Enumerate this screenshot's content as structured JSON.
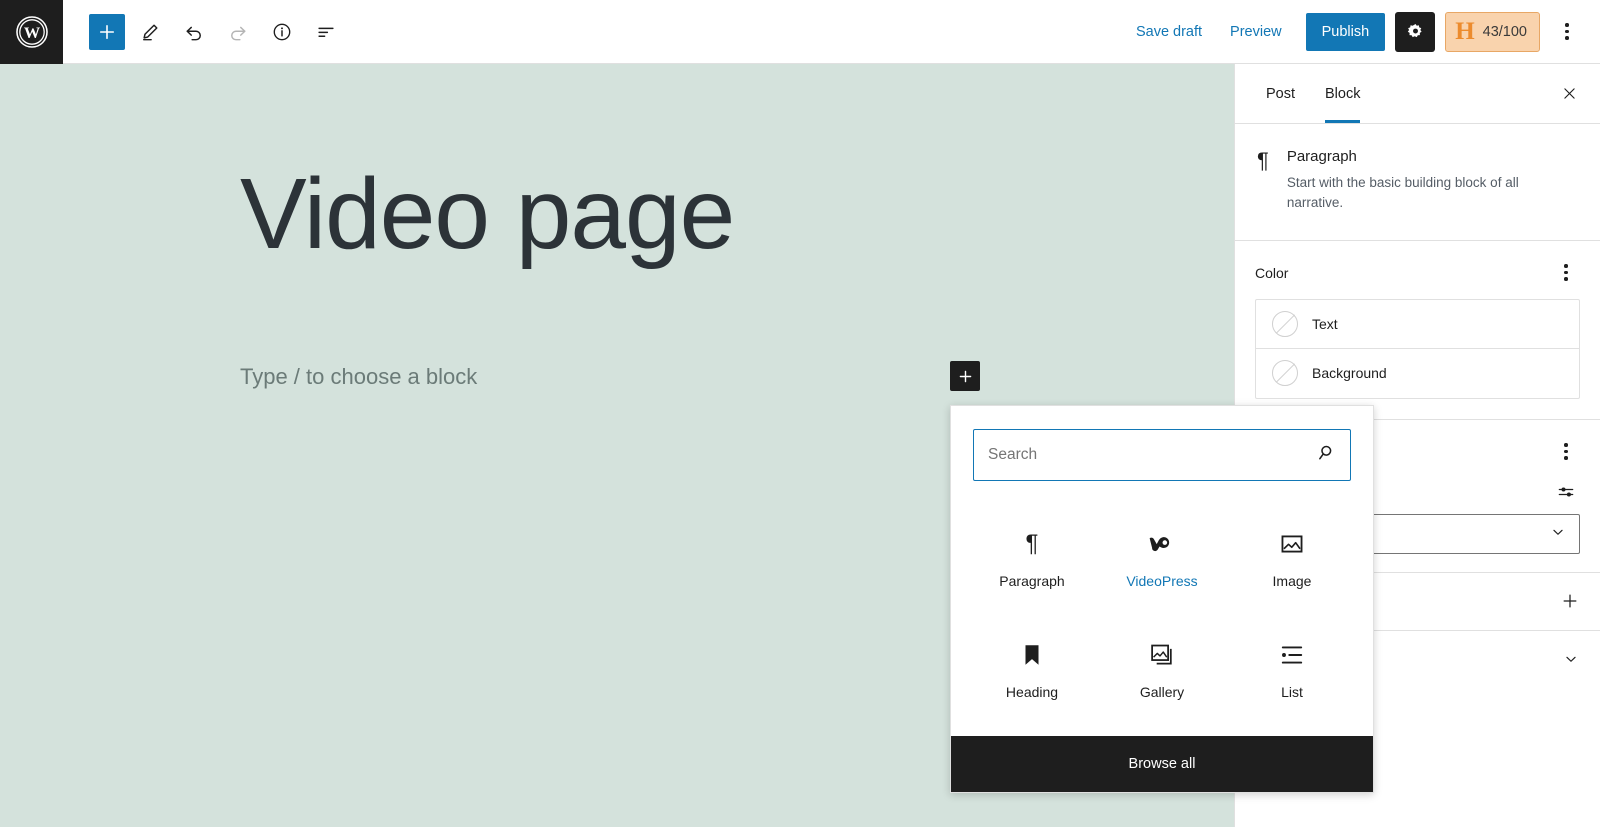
{
  "topbar": {
    "logo_icon": "wordpress-logo-icon",
    "left_tools": [
      {
        "name": "add-block-button",
        "icon": "plus-icon",
        "label": "Toggle block inserter",
        "variant": "primary"
      },
      {
        "name": "tools-button",
        "icon": "pencil-icon",
        "label": "Tools",
        "variant": "plain"
      },
      {
        "name": "undo-button",
        "icon": "undo-arrow-icon",
        "label": "Undo",
        "variant": "plain"
      },
      {
        "name": "redo-button",
        "icon": "redo-arrow-icon",
        "label": "Redo",
        "variant": "disabled"
      },
      {
        "name": "details-button",
        "icon": "info-circle-icon",
        "label": "Details",
        "variant": "plain"
      },
      {
        "name": "list-view-button",
        "icon": "list-view-icon",
        "label": "List view",
        "variant": "plain"
      }
    ],
    "save_draft_label": "Save draft",
    "preview_label": "Preview",
    "publish_label": "Publish",
    "settings_icon": "gear-icon",
    "seo_badge": {
      "mark": "H",
      "score": "43/100"
    },
    "more_menu_icon": "kebab-menu-icon"
  },
  "canvas": {
    "background_color": "#d4e2dc",
    "post_title": "Video page",
    "paragraph_placeholder": "Type / to choose a block",
    "inline_inserter_icon": "plus-icon"
  },
  "sidebar": {
    "tabs": [
      {
        "label": "Post",
        "active": false
      },
      {
        "label": "Block",
        "active": true
      }
    ],
    "close_icon": "close-x-icon",
    "block_info": {
      "icon": "paragraph-pilcrow-icon",
      "title": "Paragraph",
      "description": "Start with the basic building block of all narrative."
    },
    "color_panel": {
      "title": "Color",
      "menu_icon": "kebab-menu-icon",
      "rows": [
        {
          "label": "Text",
          "swatch": "none"
        },
        {
          "label": "Background",
          "swatch": "none"
        }
      ]
    },
    "typography_panel": {
      "menu_icon": "kebab-menu-icon",
      "options_icon": "sliders-icon",
      "select_value": "",
      "select_chevron_icon": "chevron-down-icon"
    },
    "dimensions_panel": {
      "title": "",
      "action_icon": "plus-icon"
    },
    "advanced_panel": {
      "title": "",
      "action_icon": "chevron-down-icon"
    }
  },
  "inserter": {
    "search": {
      "placeholder": "Search",
      "value": "",
      "icon": "search-magnifier-icon"
    },
    "blocks": [
      {
        "label": "Paragraph",
        "icon": "paragraph-pilcrow-icon",
        "accent": false
      },
      {
        "label": "VideoPress",
        "icon": "videopress-logo-icon",
        "accent": true
      },
      {
        "label": "Image",
        "icon": "image-icon",
        "accent": false
      },
      {
        "label": "Heading",
        "icon": "heading-bookmark-icon",
        "accent": false
      },
      {
        "label": "Gallery",
        "icon": "gallery-icon",
        "accent": false
      },
      {
        "label": "List",
        "icon": "list-icon",
        "accent": false
      }
    ],
    "browse_all_label": "Browse all"
  },
  "colors": {
    "accent_blue": "#1277b5",
    "canvas_green": "#d4e2dc",
    "dark": "#1e1e1e",
    "seo_orange": "#ec8b2d",
    "seo_badge_bg": "#f9d3ad"
  }
}
